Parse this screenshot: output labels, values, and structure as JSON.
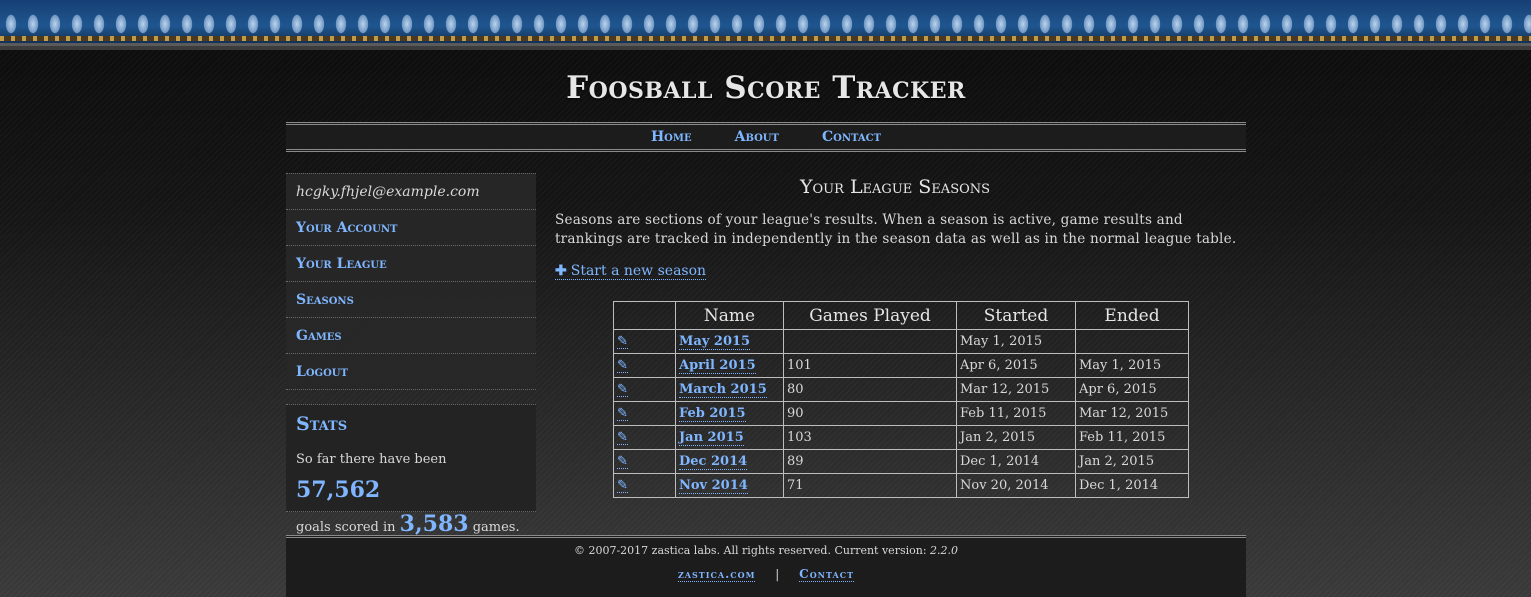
{
  "site": {
    "title": "Foosball Score Tracker"
  },
  "nav": {
    "home": "Home",
    "about": "About",
    "contact": "Contact"
  },
  "sidebar": {
    "email": "hcgky.fhjel@example.com",
    "items": [
      {
        "label": "Your Account"
      },
      {
        "label": "Your League"
      },
      {
        "label": "Seasons"
      },
      {
        "label": "Games"
      },
      {
        "label": "Logout"
      }
    ]
  },
  "stats": {
    "title": "Stats",
    "text1": "So far there have been",
    "goals": "57,562",
    "text2": "goals scored in",
    "games": "3,583",
    "text3": "games."
  },
  "main": {
    "heading": "Your League Seasons",
    "intro": "Seasons are sections of your league's results. When a season is active, game results and trankings are tracked in independently in the season data as well as in the normal league table.",
    "new_season_label": "Start a new season",
    "table": {
      "headers": [
        "",
        "Name",
        "Games Played",
        "Started",
        "Ended"
      ],
      "rows": [
        {
          "name": "May 2015",
          "games": "",
          "started": "May 1, 2015",
          "ended": ""
        },
        {
          "name": "April 2015",
          "games": "101",
          "started": "Apr 6, 2015",
          "ended": "May 1, 2015"
        },
        {
          "name": "March 2015",
          "games": "80",
          "started": "Mar 12, 2015",
          "ended": "Apr 6, 2015"
        },
        {
          "name": "Feb 2015",
          "games": "90",
          "started": "Feb 11, 2015",
          "ended": "Mar 12, 2015"
        },
        {
          "name": "Jan 2015",
          "games": "103",
          "started": "Jan 2, 2015",
          "ended": "Feb 11, 2015"
        },
        {
          "name": "Dec 2014",
          "games": "89",
          "started": "Dec 1, 2014",
          "ended": "Jan 2, 2015"
        },
        {
          "name": "Nov 2014",
          "games": "71",
          "started": "Nov 20, 2014",
          "ended": "Dec 1, 2014"
        }
      ]
    }
  },
  "footer": {
    "copyright": "© 2007-2017 zastica labs. All rights reserved. Current version:",
    "version": "2.2.0",
    "link1": "zastica.com",
    "separator": "|",
    "link2": "Contact"
  }
}
